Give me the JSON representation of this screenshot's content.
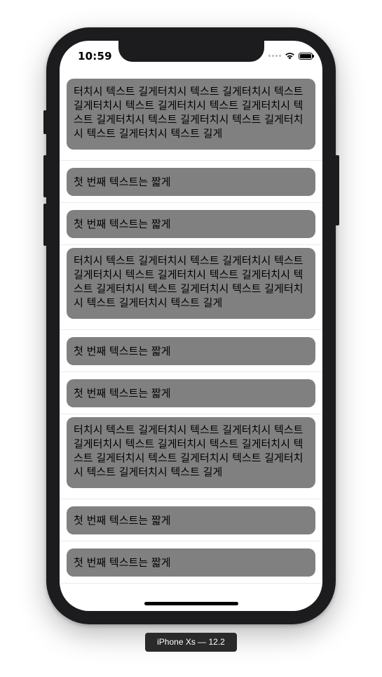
{
  "status_bar": {
    "time": "10:59"
  },
  "rows": [
    {
      "kind": "long",
      "text": "터치시 텍스트 길게터치시 텍스트 길게터치시 텍스트 길게터치시 텍스트 길게터치시 텍스트 길게터치시 텍스트 길게터치시 텍스트 길게터치시 텍스트 길게터치시 텍스트 길게터치시 텍스트 길게"
    },
    {
      "kind": "short",
      "text": "첫 번째 텍스트는 짧게"
    },
    {
      "kind": "short",
      "text": "첫 번째 텍스트는 짧게"
    },
    {
      "kind": "long",
      "text": "터치시 텍스트 길게터치시 텍스트 길게터치시 텍스트 길게터치시 텍스트 길게터치시 텍스트 길게터치시 텍스트 길게터치시 텍스트 길게터치시 텍스트 길게터치시 텍스트 길게터치시 텍스트 길게"
    },
    {
      "kind": "short",
      "text": "첫 번째 텍스트는 짧게"
    },
    {
      "kind": "short",
      "text": "첫 번째 텍스트는 짧게"
    },
    {
      "kind": "long",
      "text": "터치시 텍스트 길게터치시 텍스트 길게터치시 텍스트 길게터치시 텍스트 길게터치시 텍스트 길게터치시 텍스트 길게터치시 텍스트 길게터치시 텍스트 길게터치시 텍스트 길게터치시 텍스트 길게"
    },
    {
      "kind": "short",
      "text": "첫 번째 텍스트는 짧게"
    },
    {
      "kind": "short",
      "text": "첫 번째 텍스트는 짧게"
    }
  ],
  "device_label": "iPhone Xs — 12.2",
  "colors": {
    "cell_background": "#808080",
    "frame": "#1c1c1e"
  },
  "icons": [
    "signal-dots-icon",
    "wifi-icon",
    "battery-icon"
  ]
}
